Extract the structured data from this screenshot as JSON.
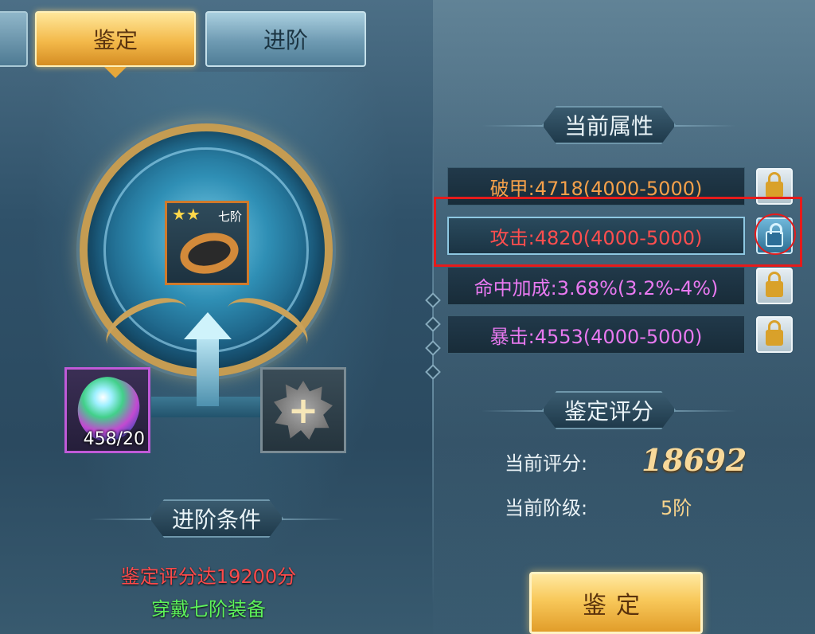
{
  "tabs": [
    {
      "label": ""
    },
    {
      "label": "鉴定"
    },
    {
      "label": "进阶"
    }
  ],
  "item": {
    "grade_label": "七阶",
    "stars": "★★"
  },
  "materials": {
    "gem_count": "458/20",
    "add_symbol": "+"
  },
  "attributes": {
    "header": "当前属性",
    "rows": [
      {
        "text": "破甲:4718(4000-5000)",
        "color": "#f4a04a",
        "locked": false
      },
      {
        "text": "攻击:4820(4000-5000)",
        "color": "#ff4e4e",
        "locked": true
      },
      {
        "text": "命中加成:3.68%(3.2%-4%)",
        "color": "#e879f0",
        "locked": false
      },
      {
        "text": "暴击:4553(4000-5000)",
        "color": "#e879f0",
        "locked": false
      }
    ]
  },
  "score": {
    "header": "鉴定评分",
    "current_score_label": "当前评分:",
    "current_score_value": "18692",
    "current_grade_label": "当前阶级:",
    "current_grade_value": "5阶"
  },
  "conditions": {
    "header": "进阶条件",
    "line1": "鉴定评分达19200分",
    "line2": "穿戴七阶装备"
  },
  "actions": {
    "identify_label": "鉴定"
  }
}
